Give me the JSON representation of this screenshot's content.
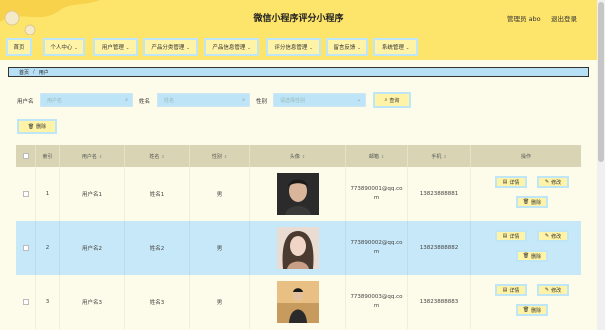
{
  "header": {
    "title": "微信小程序评分小程序",
    "admin_label": "管理员 abo",
    "logout_label": "退出登录"
  },
  "nav": {
    "items": [
      {
        "label": "首页",
        "has_caret": false
      },
      {
        "label": "个人中心",
        "has_caret": true
      },
      {
        "label": "用户管理",
        "has_caret": true
      },
      {
        "label": "产品分类管理",
        "has_caret": true
      },
      {
        "label": "产品信息管理",
        "has_caret": true
      },
      {
        "label": "评分信息管理",
        "has_caret": true
      },
      {
        "label": "留言反馈",
        "has_caret": true
      },
      {
        "label": "系统管理",
        "has_caret": true
      }
    ]
  },
  "breadcrumb": {
    "home": "首页",
    "separator": "/",
    "current": "用户"
  },
  "search": {
    "username_label": "用户名",
    "username_placeholder": "用户名",
    "name_label": "姓名",
    "name_placeholder": "姓名",
    "gender_label": "性别",
    "gender_placeholder": "请选择性别",
    "query_button": "查询",
    "delete_button": "删除"
  },
  "table": {
    "columns": {
      "index": "索引",
      "username": "用户名",
      "name": "姓名",
      "gender": "性别",
      "avatar": "头像",
      "email": "邮箱",
      "phone": "手机",
      "actions": "操作"
    },
    "rows": [
      {
        "index": "1",
        "username": "用户名1",
        "name": "姓名1",
        "gender": "男",
        "email": "773890001@qq.com",
        "phone": "13823888881",
        "avatar_colors": [
          "#2b2b2b",
          "#d9b59b",
          "#3a3a3a"
        ]
      },
      {
        "index": "2",
        "username": "用户名2",
        "name": "姓名2",
        "gender": "男",
        "email": "773890002@qq.com",
        "phone": "13823888882",
        "avatar_colors": [
          "#4a3a30",
          "#f1d6c8",
          "#c89f86"
        ]
      },
      {
        "index": "3",
        "username": "用户名3",
        "name": "姓名3",
        "gender": "男",
        "email": "773890003@qq.com",
        "phone": "13823888883",
        "avatar_colors": [
          "#c79a5e",
          "#2a2a2a",
          "#e8c083"
        ]
      }
    ],
    "detail_label": "详情",
    "edit_label": "修改",
    "delete_label": "删除"
  },
  "colors": {
    "header_bg": "#fde46a",
    "button_bg": "#fef3a6",
    "button_border": "#bfe6f7",
    "row_highlight": "#c7e8f8"
  }
}
